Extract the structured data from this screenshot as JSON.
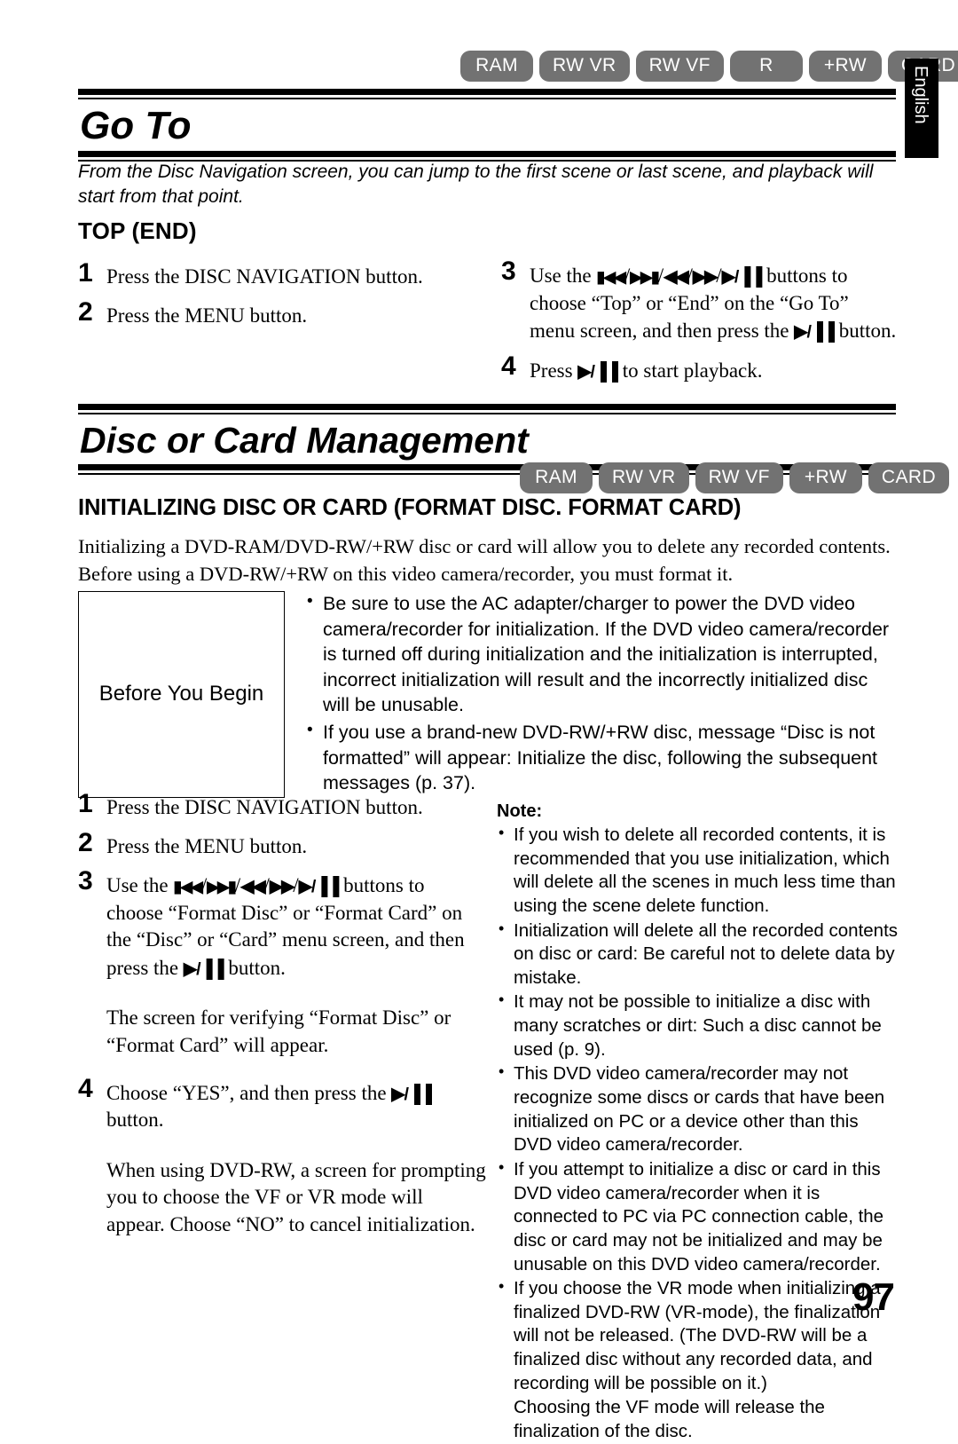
{
  "page": {
    "number": "97",
    "language_tab": "English"
  },
  "badges_top": [
    "RAM",
    "RW VR",
    "RW VF",
    "R",
    "+RW",
    "CARD"
  ],
  "badges_management": [
    "RAM",
    "RW VR",
    "RW VF",
    "+RW",
    "CARD"
  ],
  "colors": {
    "badge_background": "#727272",
    "badge_text": "#ffffff",
    "rule": "#000000",
    "language_tab_background": "#000000"
  },
  "sections": {
    "go_to": {
      "title": "Go To",
      "intro": "From the Disc Navigation screen, you can jump to the first scene or last scene, and playback will start from that point.",
      "subheading": "TOP (END)",
      "steps_left": [
        {
          "num": "1",
          "text": "Press the DISC NAVIGATION button."
        },
        {
          "num": "2",
          "text": "Press the MENU button."
        }
      ],
      "step3": {
        "num": "3",
        "part1": "Use the ",
        "part2": " buttons to choose “Top” or “End” on the “Go To” menu screen, and then press the ",
        "part3": " button."
      },
      "step4": {
        "num": "4",
        "part1": "Press ",
        "part2": " to start playback."
      }
    },
    "disc_or_card_management": {
      "title": "Disc or Card Management",
      "subheading": "INITIALIZING DISC OR CARD (FORMAT DISC. FORMAT CARD)",
      "paragraph": "Initializing a DVD-RAM/DVD-RW/+RW disc or card will allow you to delete any recorded contents. Before using a DVD-RW/+RW on this video camera/recorder, you must format it.",
      "before_you_begin": {
        "label": "Before You Begin",
        "items": [
          "Be sure to use the AC adapter/charger to power the DVD video camera/recorder for initialization. If the DVD video camera/recorder is turned off during initialization and the initialization is interrupted, incorrect initialization will result and the incorrectly initialized disc will be unusable.",
          "If you use a brand-new DVD-RW/+RW disc, message “Disc is not formatted” will appear: Initialize the disc, following the subsequent messages (p. 37)."
        ]
      },
      "steps": {
        "step1": {
          "num": "1",
          "text": "Press the DISC NAVIGATION button."
        },
        "step2": {
          "num": "2",
          "text": "Press the MENU button."
        },
        "step3": {
          "num": "3",
          "part1": "Use the ",
          "part2": " buttons to choose “Format Disc” or “Format Card” on the “Disc” or “Card” menu screen, and then press the ",
          "part3": " button."
        },
        "note_after_3": "The screen for verifying “Format Disc” or “Format Card” will appear.",
        "step4": {
          "num": "4",
          "part1": "Choose “YES”, and then press the ",
          "part2": " button."
        },
        "note_after_4": "When using DVD-RW, a screen for prompting you to choose the VF or VR mode will appear. Choose “NO” to cancel initialization."
      },
      "note": {
        "title": "Note:",
        "items": [
          "If you wish to delete all recorded contents, it is recommended that you use initialization, which will delete all the scenes in much less time than using the scene delete function.",
          "Initialization will delete all the recorded contents on disc or card: Be careful not to delete data by mistake.",
          "It may not be possible to initialize a disc with many scratches or dirt: Such a disc cannot be used (p. 9).",
          "This DVD video camera/recorder may not recognize some discs or cards that have been initialized on PC or a device other than this DVD video camera/recorder.",
          "If you attempt to initialize a disc or card in this DVD video camera/recorder when it is connected to PC via PC connection cable, the disc or card may not be initialized and may be unusable on this DVD video camera/recorder.",
          "If you choose the VR mode when initializing a finalized DVD-RW (VR-mode), the finalization will not be released. (The DVD-RW will be a finalized disc without any recorded data, and recording will be possible on it.)"
        ],
        "last_item_continuation": "Choosing the VF mode will release the finalization of the disc."
      }
    }
  },
  "icons": {
    "skip_back": "skip-back-icon",
    "skip_forward": "skip-forward-icon",
    "rewind": "rewind-icon",
    "fast_forward": "fast-forward-icon",
    "play_pause": "play-pause-icon",
    "separator": "/"
  }
}
